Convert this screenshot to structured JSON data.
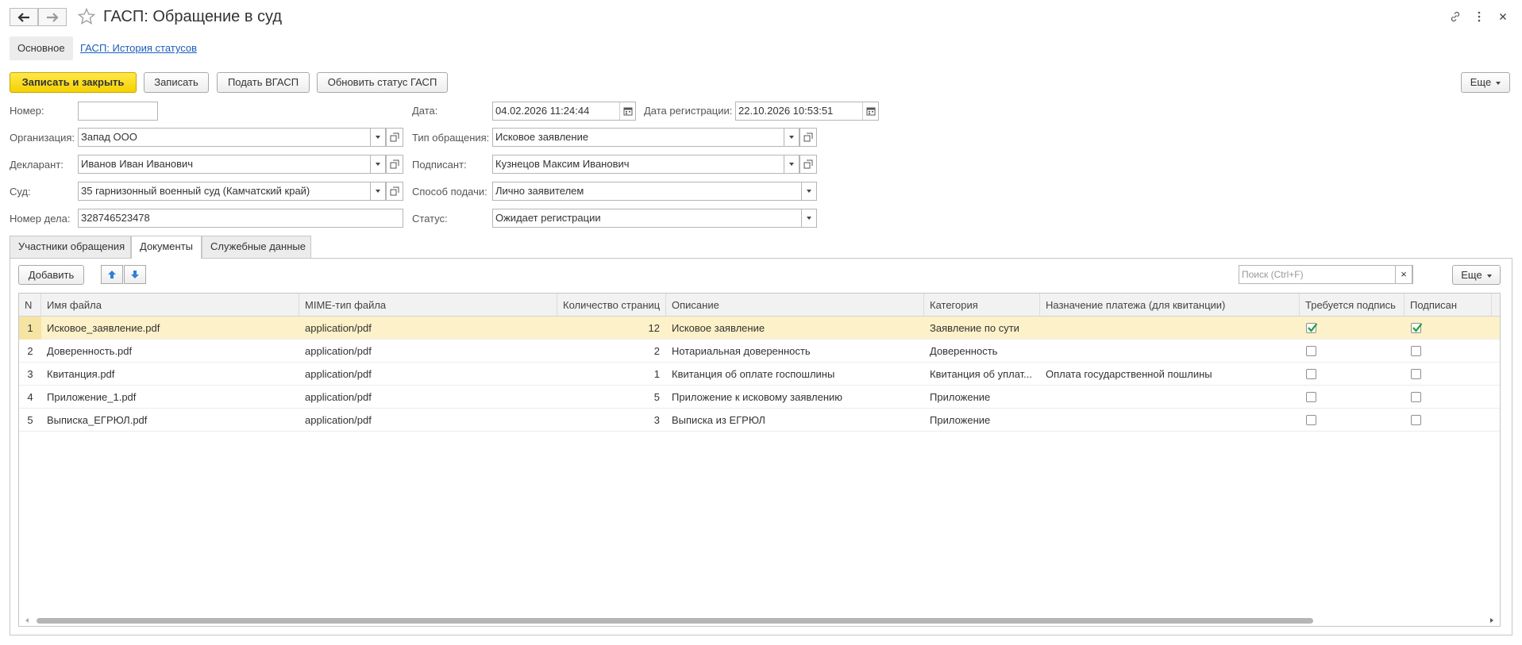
{
  "window": {
    "title": "ГАСП: Обращение в суд"
  },
  "sections": {
    "main": "Основное",
    "history_link": "ГАСП: История статусов"
  },
  "toolbar": {
    "save_close": "Записать и закрыть",
    "save": "Записать",
    "submit": "Подать ВГАСП",
    "refresh": "Обновить статус ГАСП",
    "more": "Еще"
  },
  "form": {
    "number_label": "Номер:",
    "number_value": "",
    "org_label": "Организация:",
    "org_value": "Запад ООО",
    "declarant_label": "Декларант:",
    "declarant_value": "Иванов Иван Иванович",
    "court_label": "Суд:",
    "court_value": "35 гарнизонный военный суд (Камчатский край)",
    "case_label": "Номер дела:",
    "case_value": "328746523478",
    "date_label": "Дата:",
    "date_value": "04.02.2026 11:24:44",
    "reg_date_label": "Дата регистрации:",
    "reg_date_value": "22.10.2026 10:53:51",
    "type_label": "Тип обращения:",
    "type_value": "Исковое заявление",
    "signer_label": "Подписант:",
    "signer_value": "Кузнецов Максим Иванович",
    "method_label": "Способ подачи:",
    "method_value": "Лично заявителем",
    "status_label": "Статус:",
    "status_value": "Ожидает регистрации"
  },
  "tabs": [
    {
      "label": "Участники обращения"
    },
    {
      "label": "Документы"
    },
    {
      "label": "Служебные данные"
    }
  ],
  "docs": {
    "add": "Добавить",
    "search_placeholder": "Поиск (Ctrl+F)",
    "search_clear": "×",
    "more": "Еще",
    "columns": [
      "N",
      "Имя файла",
      "MIME-тип файла",
      "Количество страниц",
      "Описание",
      "Категория",
      "Назначение платежа (для квитанции)",
      "Требуется подпись",
      "Подписан"
    ],
    "rows": [
      {
        "n": "1",
        "name": "Исковое_заявление.pdf",
        "mime": "application/pdf",
        "pages": "12",
        "desc": "Исковое заявление",
        "cat": "Заявление по сути",
        "purpose": "",
        "req_sign": true,
        "signed": true
      },
      {
        "n": "2",
        "name": "Доверенность.pdf",
        "mime": "application/pdf",
        "pages": "2",
        "desc": "Нотариальная доверенность",
        "cat": "Доверенность",
        "purpose": "",
        "req_sign": false,
        "signed": false
      },
      {
        "n": "3",
        "name": "Квитанция.pdf",
        "mime": "application/pdf",
        "pages": "1",
        "desc": "Квитанция об оплате госпошлины",
        "cat": "Квитанция об уплат...",
        "purpose": "Оплата государственной пошлины",
        "req_sign": false,
        "signed": false
      },
      {
        "n": "4",
        "name": "Приложение_1.pdf",
        "mime": "application/pdf",
        "pages": "5",
        "desc": "Приложение к исковому заявлению",
        "cat": "Приложение",
        "purpose": "",
        "req_sign": false,
        "signed": false
      },
      {
        "n": "5",
        "name": "Выписка_ЕГРЮЛ.pdf",
        "mime": "application/pdf",
        "pages": "3",
        "desc": "Выписка из ЕГРЮЛ",
        "cat": "Приложение",
        "purpose": "",
        "req_sign": false,
        "signed": false
      }
    ]
  },
  "colors": {
    "accent_yellow": "#f5d100",
    "link_blue": "#1a5ebd",
    "selected_row": "#fcf1c8",
    "check_green": "#1e9e3a"
  },
  "icons": {
    "back": "arrow-left-icon",
    "forward": "arrow-right-icon",
    "favorite": "star-icon",
    "link": "link-icon",
    "menu": "kebab-menu-icon",
    "close": "close-icon",
    "move_up": "arrow-up-icon",
    "move_down": "arrow-down-icon",
    "calendar": "calendar-icon",
    "open": "open-form-icon"
  }
}
